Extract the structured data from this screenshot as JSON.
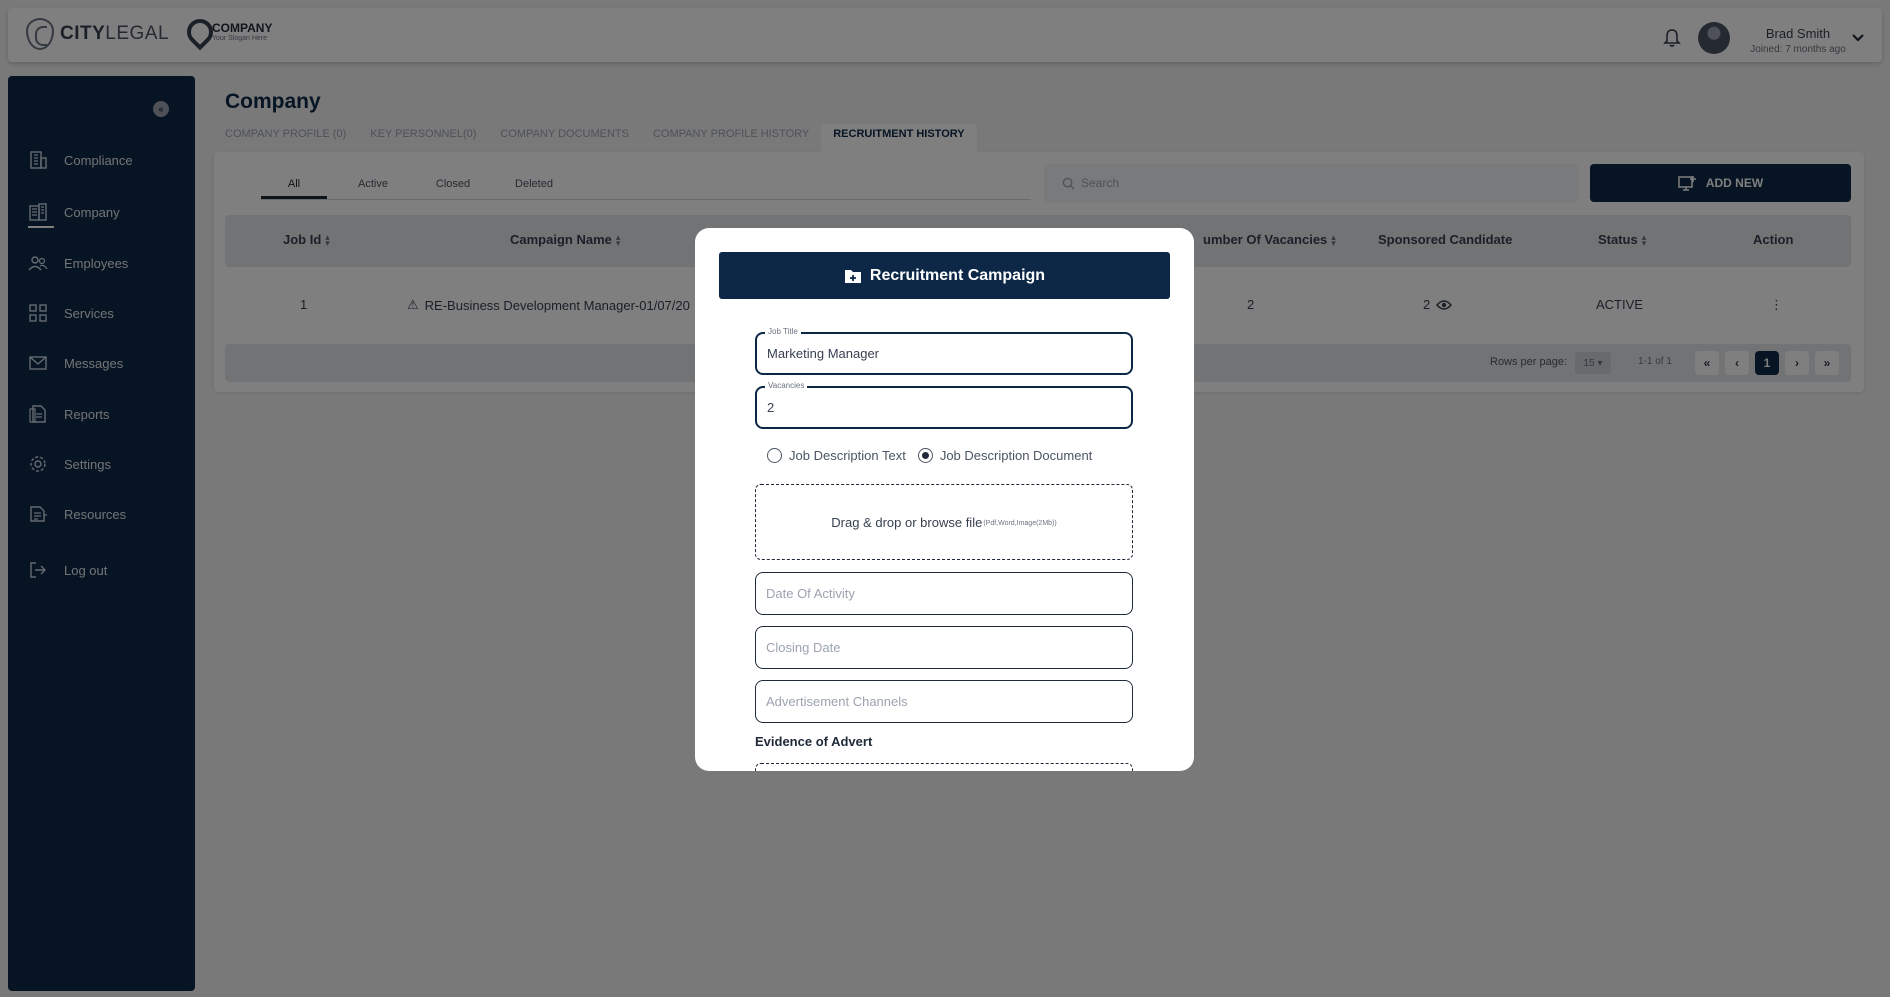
{
  "brand": {
    "logo_bold": "CITY",
    "logo_rest": "LEGAL",
    "company_name": "COMPANY",
    "company_tagline": "Your Slogan Here"
  },
  "user": {
    "name": "Brad Smith",
    "joined": "Joined: 7 months ago"
  },
  "sidebar": {
    "items": [
      {
        "label": "Compliance",
        "icon": "building-icon"
      },
      {
        "label": "Company",
        "icon": "company-icon"
      },
      {
        "label": "Employees",
        "icon": "users-icon"
      },
      {
        "label": "Services",
        "icon": "grid-icon"
      },
      {
        "label": "Messages",
        "icon": "mail-icon"
      },
      {
        "label": "Reports",
        "icon": "report-icon"
      },
      {
        "label": "Settings",
        "icon": "gear-icon"
      },
      {
        "label": "Resources",
        "icon": "resources-icon"
      },
      {
        "label": "Log out",
        "icon": "logout-icon"
      }
    ]
  },
  "page": {
    "title": "Company"
  },
  "tabs": [
    "COMPANY PROFILE (0)",
    "KEY PERSONNEL(0)",
    "COMPANY DOCUMENTS",
    "COMPANY PROFILE HISTORY",
    "RECRUITMENT HISTORY"
  ],
  "subtabs": [
    "All",
    "Active",
    "Closed",
    "Deleted"
  ],
  "search": {
    "placeholder": "Search"
  },
  "add_button": "ADD NEW",
  "table": {
    "headers": {
      "job_id": "Job Id",
      "campaign_name": "Campaign Name",
      "vacancies": "umber Of Vacancies",
      "sponsored": "Sponsored Candidate",
      "status": "Status",
      "action": "Action"
    },
    "rows": [
      {
        "job_id": "1",
        "campaign_name": "RE-Business Development Manager-01/07/20",
        "vacancies": "2",
        "sponsored": "2",
        "status": "ACTIVE"
      }
    ]
  },
  "pagination": {
    "rows_label": "Rows per page:",
    "rows_value": "15",
    "info": "1-1 of 1",
    "current_page": "1"
  },
  "modal": {
    "title": "Recruitment Campaign",
    "job_title_label": "Job Title",
    "job_title_value": "Marketing Manager",
    "vacancies_label": "Vacancies",
    "vacancies_value": "2",
    "radio_text": "Job Description Text",
    "radio_document": "Job Description Document",
    "dropzone_text": "Drag & drop or browse file",
    "dropzone_hint": "(Pdf,Word,Image(2Mb))",
    "date_activity_placeholder": "Date Of Activity",
    "closing_date_placeholder": "Closing Date",
    "channels_placeholder": "Advertisement Channels",
    "evidence_label": "Evidence of Advert"
  }
}
